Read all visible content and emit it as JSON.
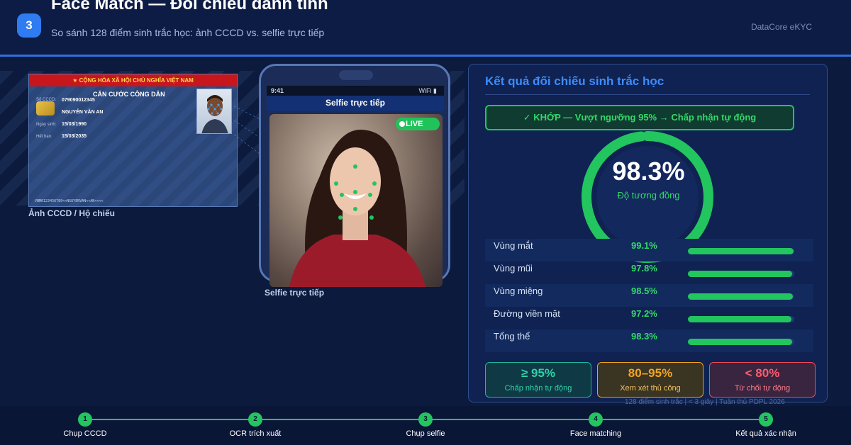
{
  "header": {
    "step": "3",
    "title": "Face Match — Đối chiếu danh tính",
    "subtitle": "So sánh 128 điểm sinh trắc học: ảnh CCCD vs. selfie trực tiếp",
    "brand": "DataCore eKYC"
  },
  "idcard": {
    "banner": "★ CỘNG HÒA XÃ HỘI CHỦ NGHĨA VIỆT NAM",
    "heading": "CĂN CƯỚC CÔNG DÂN",
    "id_label": "Số CCCD:",
    "id_value": "079090012345",
    "name_value": "NGUYỄN VĂN AN",
    "dob_label": "Ngày sinh:",
    "dob_value": "15/03/1990",
    "exp_label": "Hết hạn:",
    "exp_value": "15/03/2035",
    "mrz": "VNM0123456789<<NGUYENVAN<<AN<<<<",
    "caption": "Ảnh CCCD / Hộ chiếu"
  },
  "phone": {
    "time": "9:41",
    "wifi": "WiFi ▮",
    "title": "Selfie trực tiếp",
    "live": "LIVE",
    "caption": "Selfie trực tiếp"
  },
  "result": {
    "title": "Kết quả đối chiếu sinh trắc học",
    "verdict": "✓ KHỚP — Vượt ngưỡng 95% → Chấp nhận tự động",
    "score": "98.3%",
    "score_fraction": 0.983,
    "score_label": "Độ tương đồng",
    "rows": [
      {
        "name": "Vùng mắt",
        "value": "99.1%",
        "pct": 99.1
      },
      {
        "name": "Vùng mũi",
        "value": "97.8%",
        "pct": 97.8
      },
      {
        "name": "Vùng miệng",
        "value": "98.5%",
        "pct": 98.5
      },
      {
        "name": "Đường viền mặt",
        "value": "97.2%",
        "pct": 97.2
      },
      {
        "name": "Tổng thể",
        "value": "98.3%",
        "pct": 98.3
      }
    ],
    "legend": [
      {
        "title": "≥ 95%",
        "sub": "Chấp nhận tự động"
      },
      {
        "title": "80–95%",
        "sub": "Xem xét thủ công"
      },
      {
        "title": "< 80%",
        "sub": "Từ chối tự động"
      }
    ],
    "footnote": "128 điểm sinh trắc | < 3 giây | Tuân thủ PDPL 2026"
  },
  "pipeline": [
    {
      "num": "1",
      "label": "Chụp CCCD"
    },
    {
      "num": "2",
      "label": "OCR trích xuất"
    },
    {
      "num": "3",
      "label": "Chụp selfie"
    },
    {
      "num": "4",
      "label": "Face matching"
    },
    {
      "num": "5",
      "label": "Kết quả xác nhận"
    }
  ],
  "colors": {
    "accent": "#2f7bf2",
    "match": "#22c55e",
    "warn": "#f5a623",
    "reject": "#ff5c6c"
  }
}
